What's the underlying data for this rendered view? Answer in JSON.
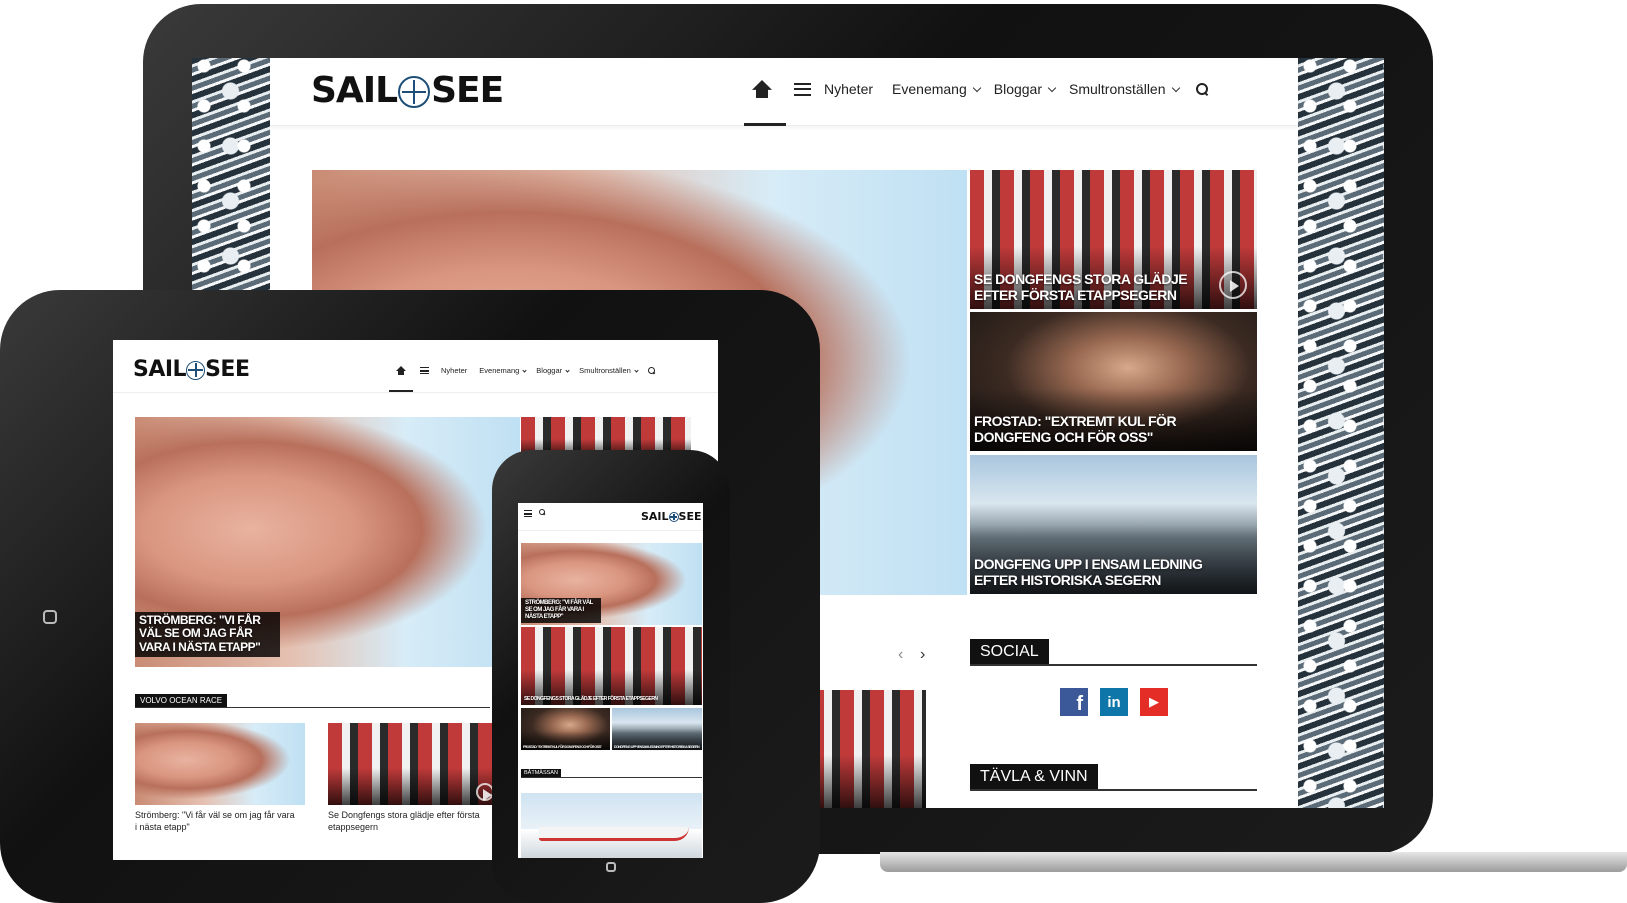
{
  "site": {
    "logo_left": "SAIL",
    "logo_right": "SEE",
    "nav": {
      "news": "Nyheter",
      "events": "Evenemang",
      "blogs": "Bloggar",
      "places": "Smultronställen"
    }
  },
  "laptop": {
    "side_stories": [
      {
        "title": "SE DONGFENGS STORA GLÄDJE EFTER FÖRSTA ETAPPSEGERN"
      },
      {
        "title": "FROSTAD: \"EXTREMT KUL FÖR DONGFENG OCH FÖR OSS\""
      },
      {
        "title": "DONGFENG UPP I ENSAM LEDNING EFTER HISTORISKA SEGERN"
      }
    ],
    "social_heading": "SOCIAL",
    "contest_heading": "TÄVLA & VINN",
    "social_icons": [
      {
        "name": "facebook",
        "glyph": "f",
        "color": "#3b5998"
      },
      {
        "name": "linkedin",
        "glyph": "in",
        "color": "#0e76a8"
      },
      {
        "name": "youtube",
        "glyph": "▶",
        "color": "#e52d27"
      }
    ]
  },
  "tablet": {
    "hero_title": "STRÖMBERG: \"VI FÅR VÄL SE OM JAG FÅR VARA I NÄSTA ETAPP\"",
    "section_label": "VOLVO OCEAN RACE",
    "cards": [
      {
        "caption": "Strömberg: \"Vi får väl se om jag får vara i nästa etapp\""
      },
      {
        "caption": "Se Dongfengs stora glädje efter första etappsegern"
      }
    ]
  },
  "phone": {
    "hero_title": "STRÖMBERG: \"VI FÅR VÄL SE OM JAG FÅR VARA I NÄSTA ETAPP\"",
    "second_title": "SE DONGFENGS STORA GLÄDJE EFTER FÖRSTA ETAPPSEGERN",
    "small_a": "FROSTAD: \"EXTREMT KUL FÖR DONGFENG OCH FÖR OSS\"",
    "small_b": "DONGFENG UPP I ENSAM LEDNING EFTER HISTORISKA SEGERN",
    "section_label": "BÅTMÄSSAN"
  }
}
